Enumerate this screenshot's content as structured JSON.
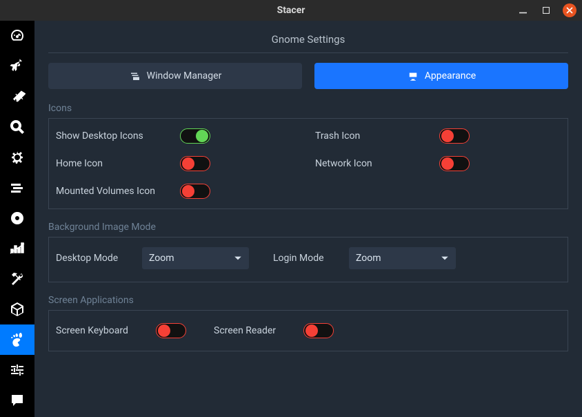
{
  "window": {
    "title": "Stacer"
  },
  "page_title": "Gnome Settings",
  "tabs": {
    "window_manager": "Window Manager",
    "appearance": "Appearance"
  },
  "sections": {
    "icons": {
      "title": "Icons",
      "items": {
        "show_desktop_icons": {
          "label": "Show Desktop Icons",
          "value": true
        },
        "trash_icon": {
          "label": "Trash Icon",
          "value": false
        },
        "home_icon": {
          "label": "Home Icon",
          "value": false
        },
        "network_icon": {
          "label": "Network Icon",
          "value": false
        },
        "mounted_volumes_icon": {
          "label": "Mounted Volumes Icon",
          "value": false
        }
      }
    },
    "background": {
      "title": "Background Image Mode",
      "desktop_mode": {
        "label": "Desktop Mode",
        "value": "Zoom"
      },
      "login_mode": {
        "label": "Login Mode",
        "value": "Zoom"
      }
    },
    "screen": {
      "title": "Screen Applications",
      "items": {
        "keyboard": {
          "label": "Screen Keyboard",
          "value": false
        },
        "reader": {
          "label": "Screen Reader",
          "value": false
        }
      }
    }
  },
  "sidebar": {
    "items": [
      {
        "name": "dashboard",
        "active": false
      },
      {
        "name": "startup-apps",
        "active": false
      },
      {
        "name": "system-cleaner",
        "active": false
      },
      {
        "name": "search",
        "active": false
      },
      {
        "name": "services",
        "active": false
      },
      {
        "name": "processes",
        "active": false
      },
      {
        "name": "uninstaller",
        "active": false
      },
      {
        "name": "resources",
        "active": false
      },
      {
        "name": "settings-tools",
        "active": false
      },
      {
        "name": "apt-repos",
        "active": false
      },
      {
        "name": "gnome-settings",
        "active": true
      },
      {
        "name": "preferences",
        "active": false
      },
      {
        "name": "feedback",
        "active": false
      }
    ]
  }
}
